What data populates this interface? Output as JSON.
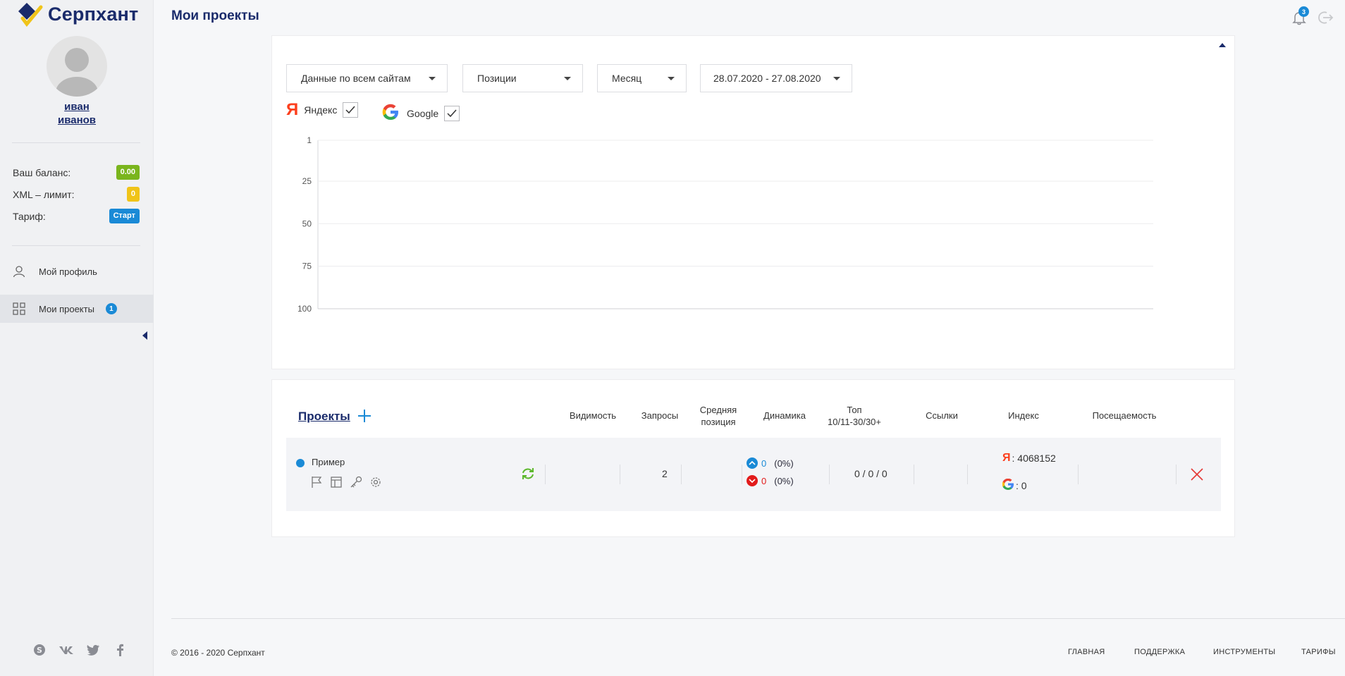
{
  "brand": {
    "name": "Серпхант"
  },
  "user": {
    "first_name": "иван",
    "last_name": "иванов"
  },
  "stats": [
    {
      "label": "Ваш баланс:",
      "value": "0.00",
      "color": "#7ab51d"
    },
    {
      "label": "XML – лимит:",
      "value": "0",
      "color": "#f0c419"
    },
    {
      "label": "Тариф:",
      "value": "Старт",
      "color": "#1a8ad6"
    }
  ],
  "nav": [
    {
      "label": "Мой профиль",
      "icon": "user-icon"
    },
    {
      "label": "Мои проекты",
      "icon": "grid-icon",
      "count": "1",
      "active": true
    }
  ],
  "header": {
    "title": "Мои проекты",
    "notifications": "3"
  },
  "filters": {
    "site": "Данные по всем сайтам",
    "metric": "Позиции",
    "period": "Месяц",
    "date_range": "28.07.2020 - 27.08.2020"
  },
  "engines": [
    {
      "name": "Яндекс",
      "checked": true
    },
    {
      "name": "Google",
      "checked": true
    }
  ],
  "chart_data": {
    "type": "line",
    "yticks": [
      "1",
      "25",
      "50",
      "75",
      "100"
    ],
    "ylim": [
      1,
      100
    ],
    "y_inverted": true,
    "grid": true,
    "series": []
  },
  "projects": {
    "title": "Проекты",
    "columns": {
      "visibility": "Видимость",
      "queries": "Запросы",
      "avg_line1": "Средняя",
      "avg_line2": "позиция",
      "dynamics": "Динамика",
      "top_line1": "Топ",
      "top_line2": "10/11-30/30+",
      "links": "Ссылки",
      "index": "Индекс",
      "traffic": "Посещаемость"
    },
    "rows": [
      {
        "name": "Пример",
        "queries": "2",
        "dyn_up": "0",
        "dyn_up_pct": "(0%)",
        "dyn_down": "0",
        "dyn_down_pct": "(0%)",
        "top": "0 / 0 / 0",
        "index_yandex": ": 4068152",
        "index_google": ": 0"
      }
    ]
  },
  "footer": {
    "copyright": "© 2016 - 2020 Серпхант",
    "links": [
      "ГЛАВНАЯ",
      "ПОДДЕРЖКА",
      "ИНСТРУМЕНТЫ",
      "ТАРИФЫ"
    ]
  }
}
